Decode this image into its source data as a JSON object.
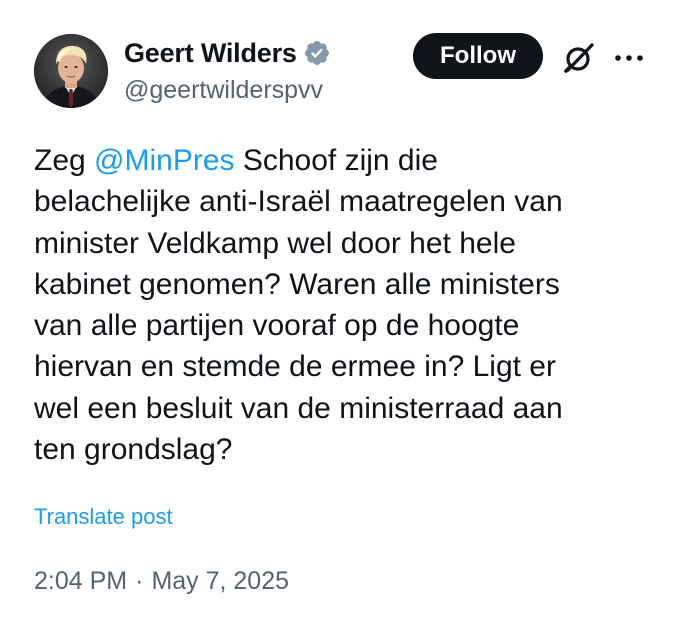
{
  "author": {
    "display_name": "Geert Wilders",
    "handle": "@geertwilderspvv",
    "verified": true
  },
  "actions": {
    "follow_label": "Follow",
    "grok_icon": "grok-icon",
    "more_icon": "more-icon"
  },
  "tweet": {
    "lines": [
      {
        "before": "Zeg ",
        "mention": "@MinPres",
        "after": " Schoof zijn die"
      },
      {
        "text": "belachelijke anti-Israël maatregelen van"
      },
      {
        "text": "minister Veldkamp wel door het hele"
      },
      {
        "text": "kabinet genomen? Waren alle ministers"
      },
      {
        "text": "van alle partijen vooraf op de hoogte"
      },
      {
        "text": "hiervan en stemde de ermee in? Ligt er"
      },
      {
        "text": "wel een besluit van de ministerraad aan"
      },
      {
        "text": "ten grondslag?"
      }
    ],
    "translate_label": "Translate post",
    "time": "2:04 PM",
    "separator": "·",
    "date": "May 7, 2025"
  },
  "colors": {
    "link": "#1d9bf0",
    "text": "#0f1419",
    "secondary": "#536471",
    "follow_bg": "#0f1419"
  }
}
